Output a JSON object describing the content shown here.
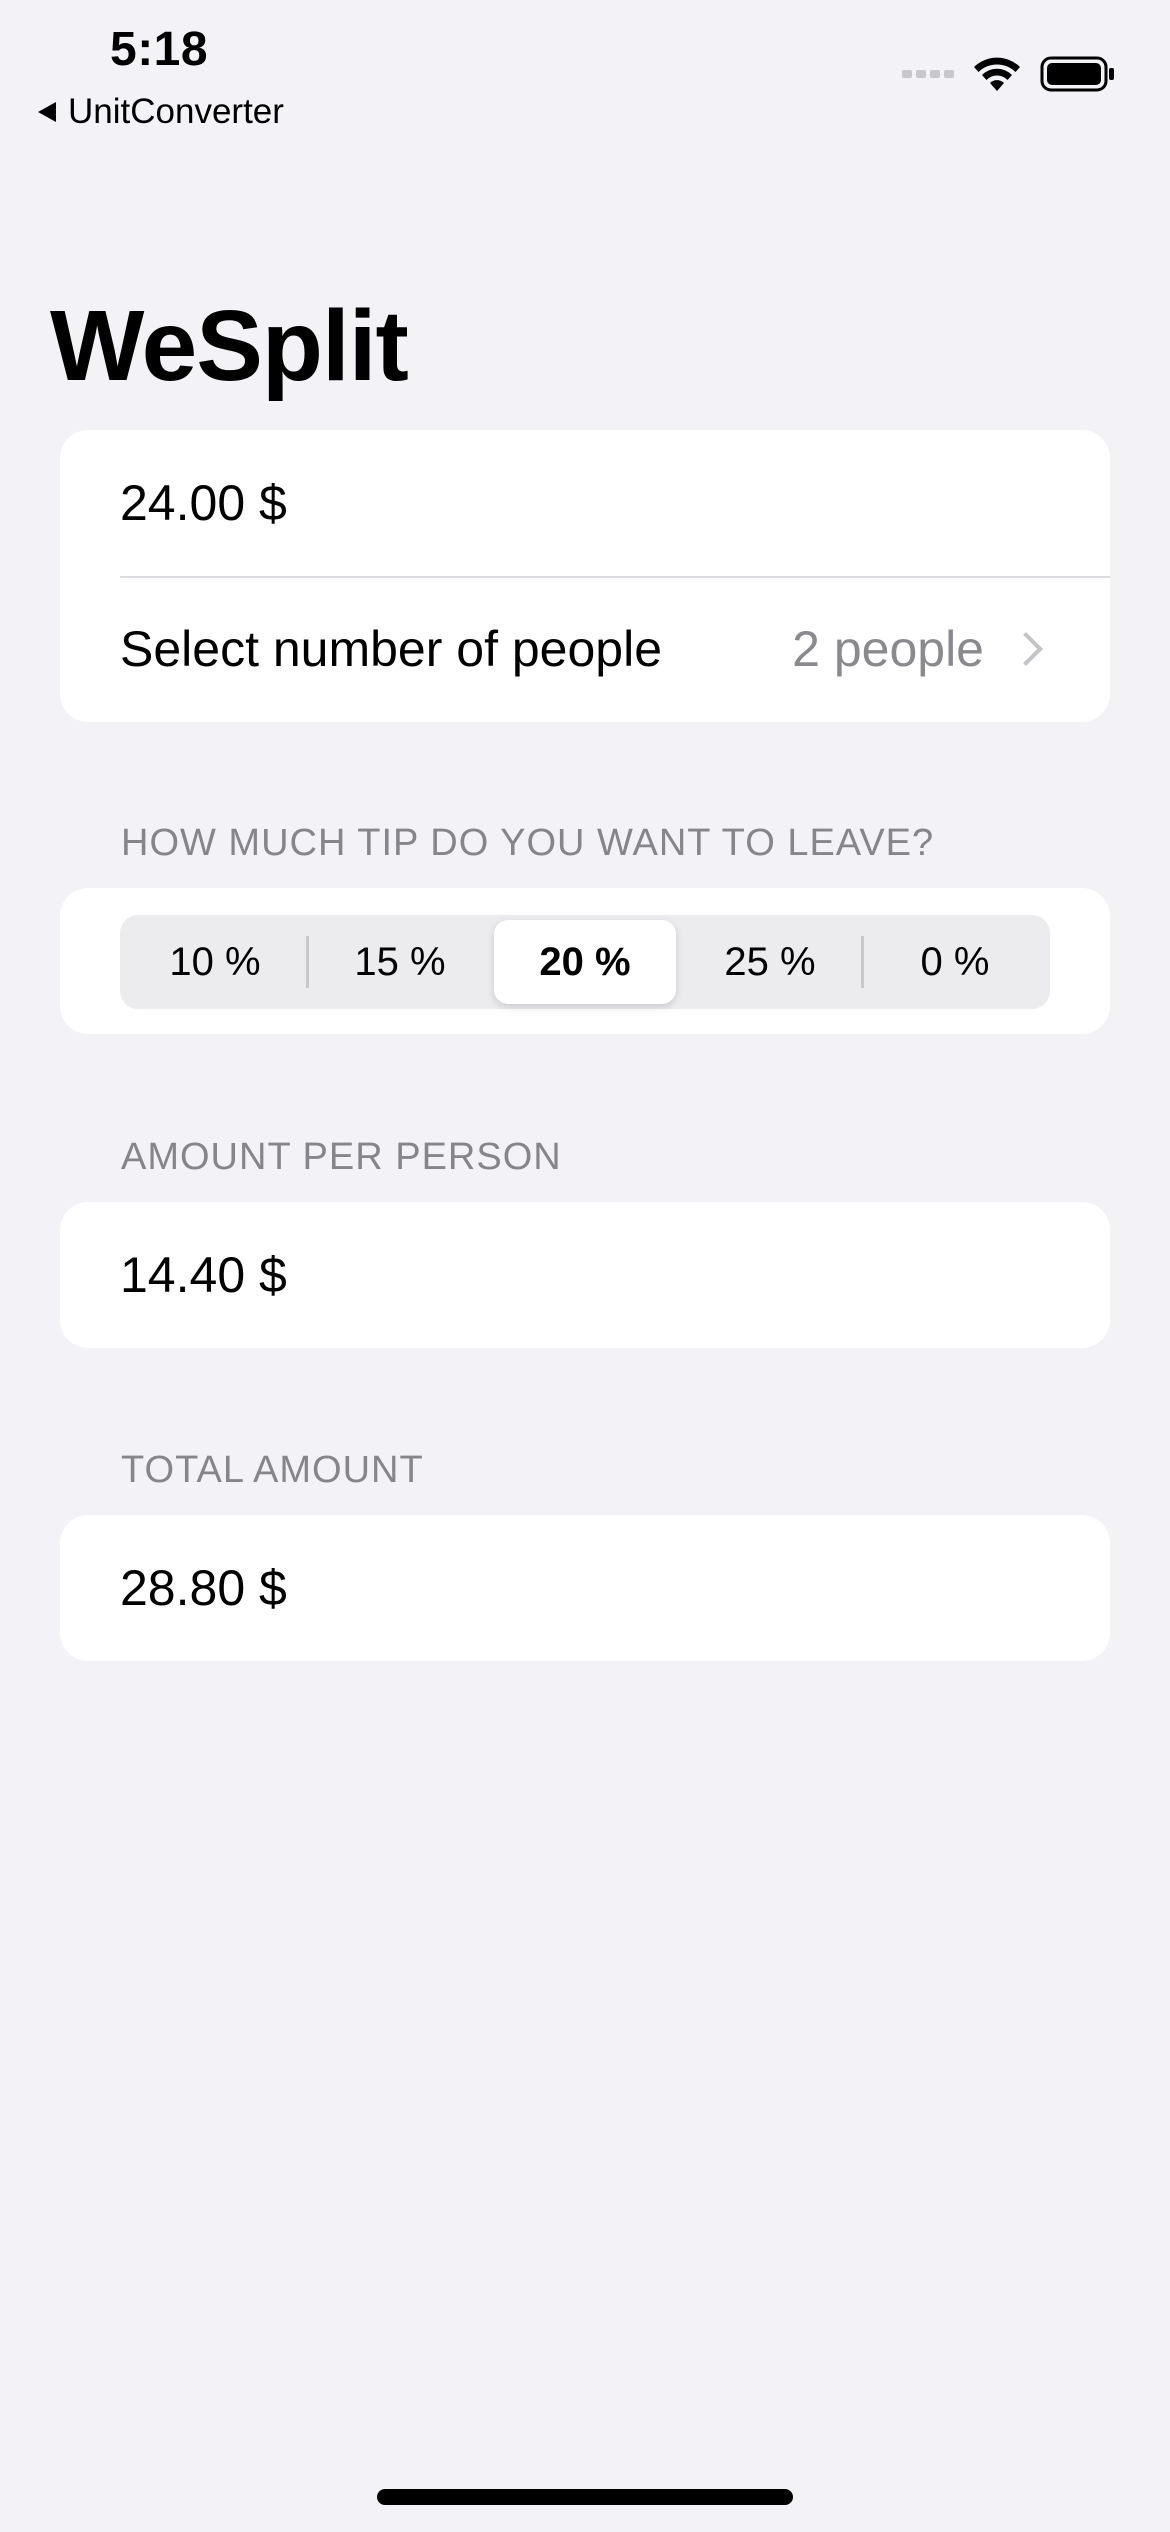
{
  "status_bar": {
    "time": "5:18",
    "back_app": "UnitConverter"
  },
  "title": "WeSplit",
  "input_section": {
    "amount": "24.00 $",
    "people_label": "Select number of people",
    "people_value": "2 people"
  },
  "tip_section": {
    "header": "HOW MUCH TIP DO YOU WANT TO LEAVE?",
    "options": [
      "10 %",
      "15 %",
      "20 %",
      "25 %",
      "0 %"
    ],
    "selected": "20 %"
  },
  "per_person_section": {
    "header": "AMOUNT PER PERSON",
    "value": "14.40 $"
  },
  "total_section": {
    "header": "TOTAL AMOUNT",
    "value": "28.80 $"
  }
}
